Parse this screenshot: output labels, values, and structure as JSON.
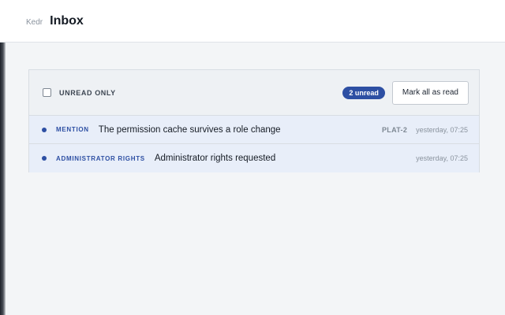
{
  "header": {
    "brand": "Kedr",
    "title": "Inbox"
  },
  "toolbar": {
    "filter_label": "UNREAD ONLY",
    "unread_badge": "2 unread",
    "mark_all_label": "Mark all as read"
  },
  "notifications": [
    {
      "kind": "MENTION",
      "message": "The permission cache survives a role change",
      "ref": "PLAT-2",
      "time": "yesterday, 07:25",
      "unread": true
    },
    {
      "kind": "ADMINISTRATOR RIGHTS",
      "message": "Administrator rights requested",
      "ref": "",
      "time": "yesterday, 07:25",
      "unread": true
    }
  ],
  "colors": {
    "accent": "#2d4fa3",
    "unread_row": "#e8eef9"
  }
}
